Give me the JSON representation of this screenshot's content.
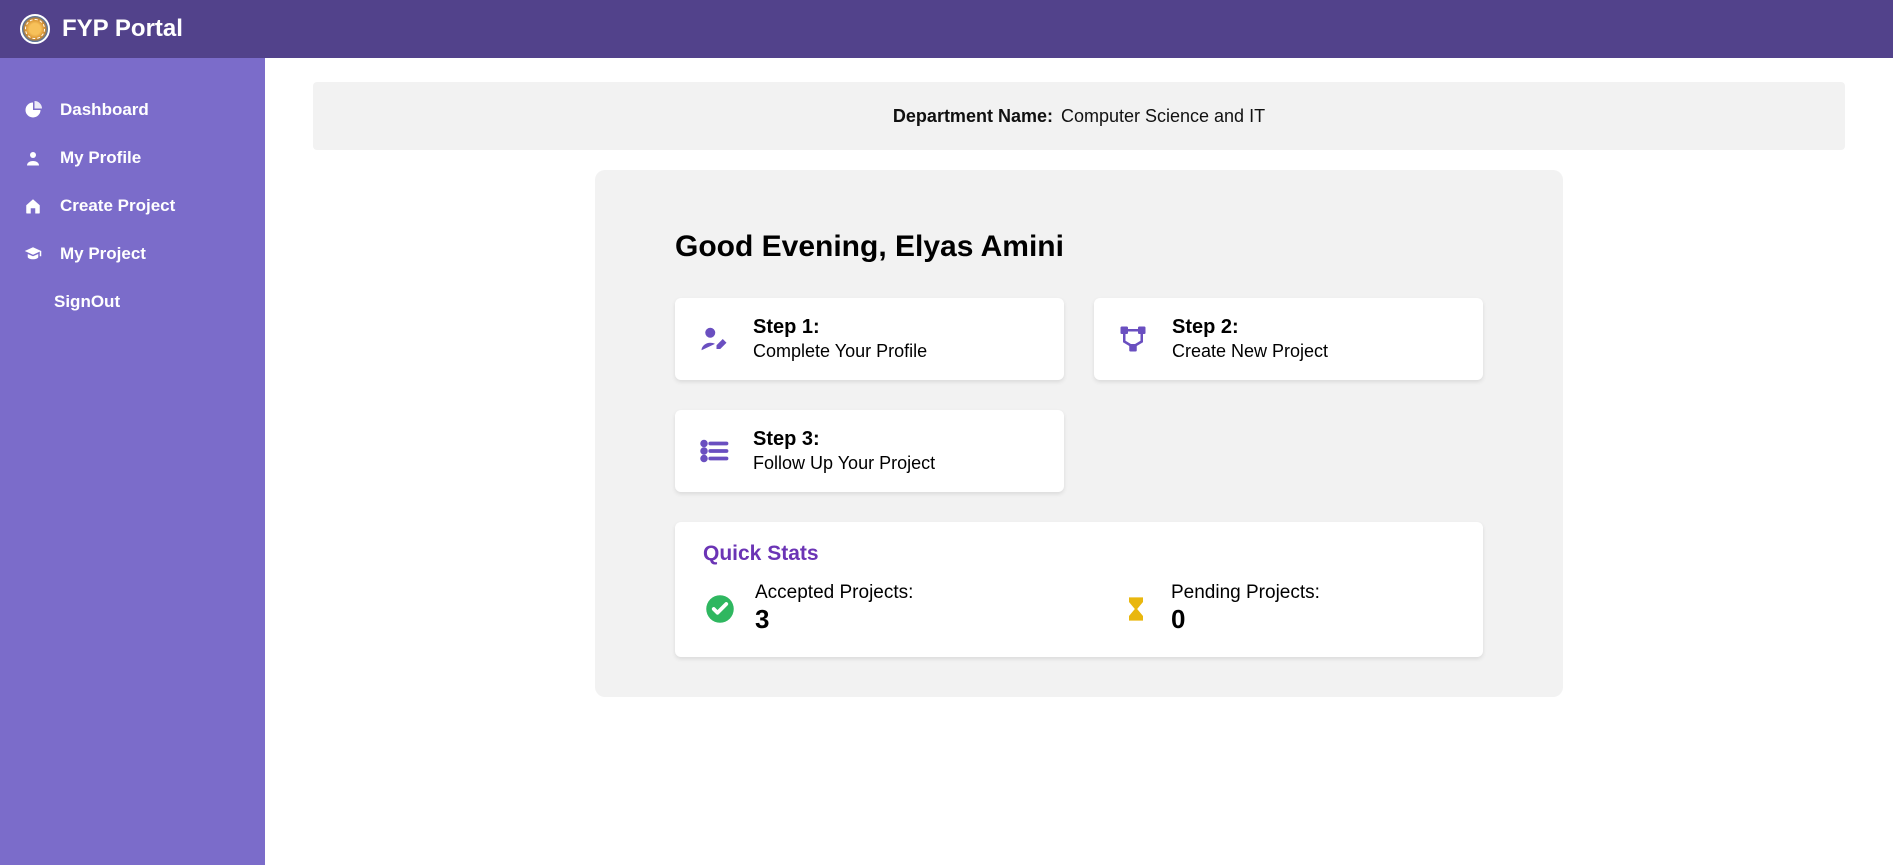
{
  "header": {
    "app_title": "FYP Portal"
  },
  "sidebar": {
    "items": [
      {
        "label": "Dashboard",
        "icon": "pie-icon"
      },
      {
        "label": "My Profile",
        "icon": "grad-icon"
      },
      {
        "label": "Create Project",
        "icon": "house-icon"
      },
      {
        "label": "My Project",
        "icon": "cap-icon"
      },
      {
        "label": "SignOut",
        "icon": ""
      }
    ]
  },
  "department": {
    "label": "Department Name:",
    "value": "Computer Science and IT"
  },
  "dashboard": {
    "greeting": "Good Evening, Elyas Amini",
    "steps": [
      {
        "title": "Step 1:",
        "desc": "Complete Your Profile"
      },
      {
        "title": "Step 2:",
        "desc": "Create New Project"
      },
      {
        "title": "Step 3:",
        "desc": "Follow Up Your Project"
      }
    ],
    "stats_title": "Quick Stats",
    "stats": {
      "accepted": {
        "label": "Accepted Projects:",
        "value": "3"
      },
      "pending": {
        "label": "Pending Projects:",
        "value": "0"
      }
    }
  },
  "colors": {
    "accent": "#6a4fc0",
    "sidebar": "#7b6cca",
    "header": "#52428b",
    "stats_title": "#6b34b5",
    "ok": "#2fb760",
    "warn": "#e9b70e"
  }
}
